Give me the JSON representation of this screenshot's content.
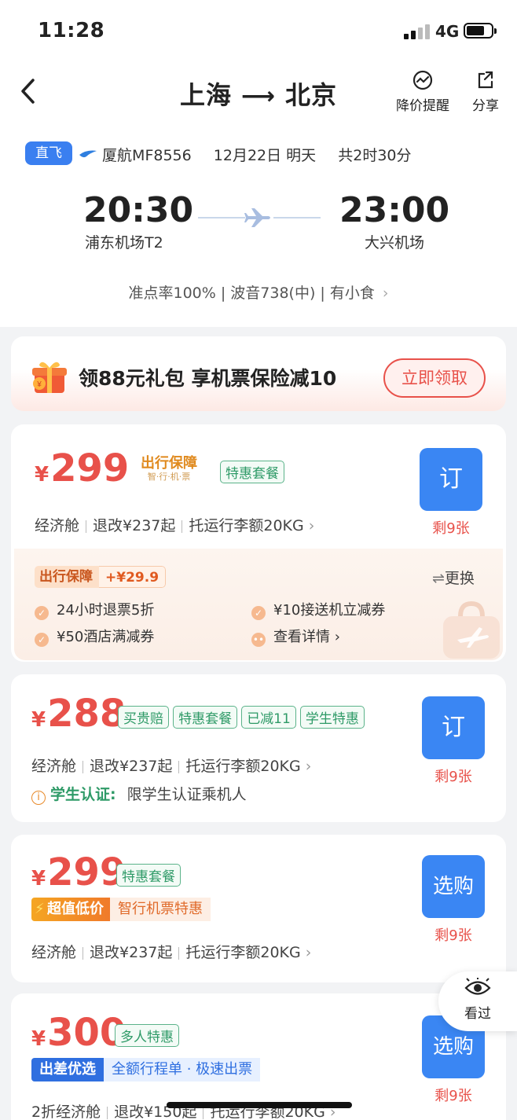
{
  "status": {
    "time": "11:28",
    "network": "4G"
  },
  "header": {
    "origin": "上海",
    "destination": "北京",
    "price_alert": "降价提醒",
    "share": "分享"
  },
  "flight": {
    "direct_tag": "直飞",
    "airline": "厦航MF8556",
    "date": "12月22日 明天",
    "duration": "共2时30分",
    "dep_time": "20:30",
    "arr_time": "23:00",
    "dep_airport": "浦东机场T2",
    "arr_airport": "大兴机场",
    "details": "准点率100% | 波音738(中) | 有小食"
  },
  "promo": {
    "text": "领88元礼包 享机票保险减10",
    "button": "立即领取"
  },
  "offers": [
    {
      "yen": "¥",
      "price": "299",
      "badge": "出行保障",
      "badge_sub": "智·行·机·票",
      "tags": [
        "特惠套餐"
      ],
      "info": [
        "经济舱",
        "退改¥237起",
        "托运行李额20KG"
      ],
      "button": "订",
      "remaining": "剩9张",
      "insurance": {
        "tag": "出行保障",
        "price": "+¥29.9",
        "swap": "更换",
        "items": [
          "24小时退票5折",
          "¥10接送机立减券",
          "¥50酒店满减券",
          "查看详情"
        ]
      }
    },
    {
      "yen": "¥",
      "price": "288",
      "tags": [
        "买贵赔",
        "特惠套餐",
        "已减11",
        "学生特惠"
      ],
      "info": [
        "经济舱",
        "退改¥237起",
        "托运行李额20KG"
      ],
      "student_label": "学生认证:",
      "student_text": "限学生认证乘机人",
      "button": "订",
      "remaining": "剩9张"
    },
    {
      "yen": "¥",
      "price": "299",
      "tags": [
        "特惠套餐"
      ],
      "highlight": "超值低价",
      "highlight_sub": "智行机票特惠",
      "info": [
        "经济舱",
        "退改¥237起",
        "托运行李额20KG"
      ],
      "button": "选购",
      "remaining": "剩9张"
    },
    {
      "yen": "¥",
      "price": "300",
      "tags": [
        "多人特惠"
      ],
      "highlight": "出差优选",
      "highlight_sub": "全额行程单 · 极速出票",
      "info": [
        "2折经济舱",
        "退改¥150起",
        "托运行李额20KG"
      ],
      "button": "选购",
      "remaining": "剩9张"
    }
  ],
  "floating": {
    "seen": "看过"
  },
  "colors": {
    "accent_blue": "#3a86f3",
    "price_red": "#e8514a",
    "tag_green": "#2e9a67"
  }
}
